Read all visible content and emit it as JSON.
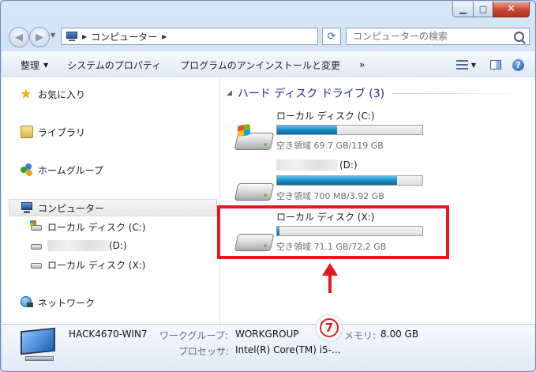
{
  "window": {
    "controls": {
      "minimize": "▁",
      "maximize": "□",
      "close": "✕"
    }
  },
  "nav": {
    "back_glyph": "◀",
    "forward_glyph": "▶",
    "dropdown_glyph": "▼",
    "address_sep": "▶",
    "address_path": "コンピューター",
    "address_sep_end": "▶",
    "refresh_glyph": "⟳",
    "search_placeholder": "コンピューターの検索"
  },
  "toolbar": {
    "organize": "整理",
    "organize_caret": "▼",
    "system_properties": "システムのプロパティ",
    "uninstall": "プログラムのアンインストールと変更",
    "more": "»",
    "view_caret": "▼",
    "help": "?"
  },
  "sidebar": {
    "favorites": "お気に入り",
    "libraries": "ライブラリ",
    "homegroup": "ホームグループ",
    "computer": "コンピューター",
    "drive_c": "ローカル ディスク (C:)",
    "drive_d": "(D:)",
    "drive_x": "ローカル ディスク (X:)",
    "network": "ネットワーク"
  },
  "content": {
    "group_glyph": "◢",
    "group_title": "ハード ディスク ドライブ (3)",
    "drives": [
      {
        "name": "ローカル ディスク (C:)",
        "free": "空き領域 69.7 GB/119 GB",
        "used_fraction": 0.414
      },
      {
        "name": "(D:)",
        "free": "空き領域 700 MB/3.92 GB",
        "used_fraction": 0.826
      },
      {
        "name": "ローカル ディスク (X:)",
        "free": "空き領域 71.1 GB/72.2 GB",
        "used_fraction": 0.015
      }
    ]
  },
  "details": {
    "computer_name": "HACK4670-WIN7",
    "workgroup_label": "ワークグループ:",
    "workgroup_value": "WORKGROUP",
    "memory_label": "メモリ:",
    "memory_value": "8.00 GB",
    "processor_label": "プロセッサ:",
    "processor_value": "Intel(R) Core(TM) i5-..."
  },
  "annotation": {
    "step_number": "7",
    "color": "#e5181d"
  }
}
